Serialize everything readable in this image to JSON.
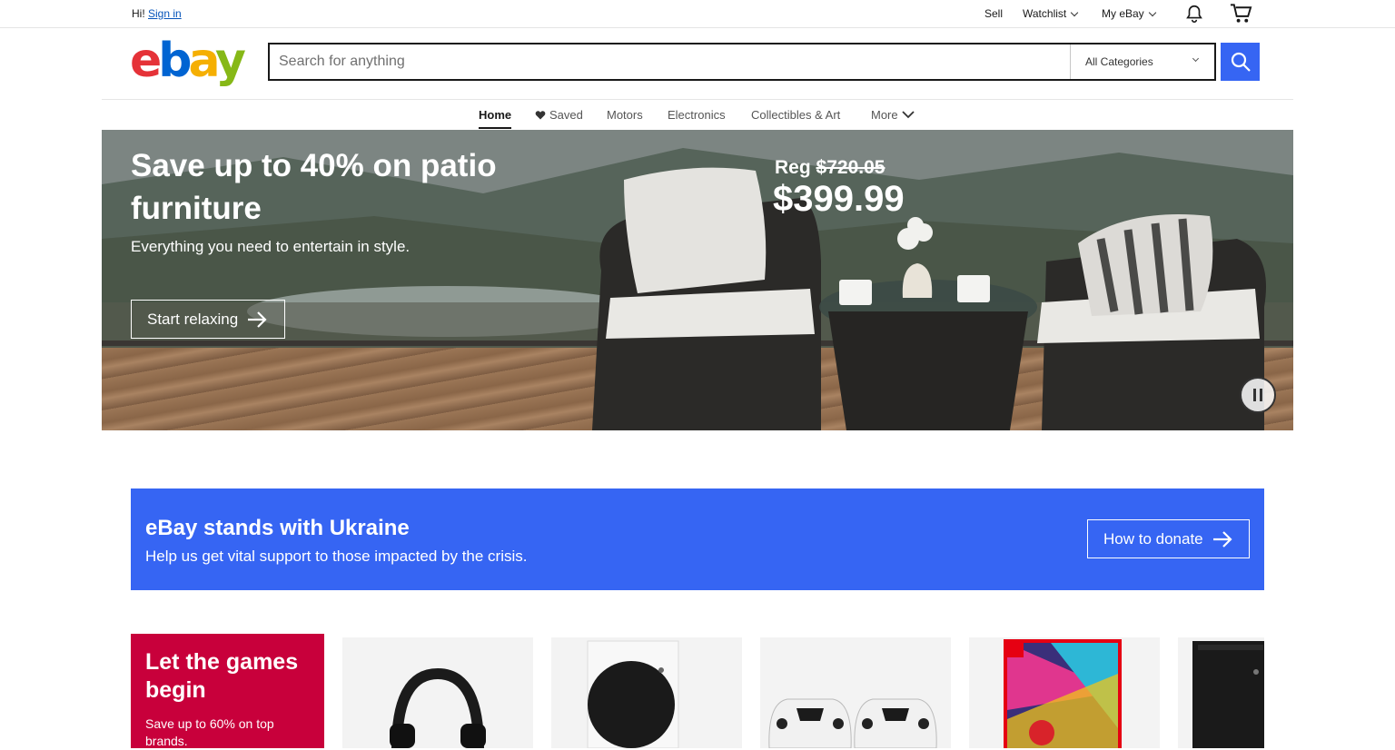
{
  "topbar": {
    "greeting": "Hi!",
    "sign_in": "Sign in",
    "sell": "Sell",
    "watchlist": "Watchlist",
    "my_ebay": "My eBay"
  },
  "header": {
    "logo_letters": [
      "e",
      "b",
      "a",
      "y"
    ],
    "search_placeholder": "Search for anything",
    "category": "All Categories"
  },
  "nav": {
    "items": [
      "Home",
      "Saved",
      "Motors",
      "Electronics",
      "Collectibles & Art",
      "More"
    ]
  },
  "hero": {
    "title": "Save up to 40% on patio furniture",
    "subtitle": "Everything you need to entertain in style.",
    "cta": "Start relaxing",
    "reg_label": "Reg",
    "reg_price": "$720.05",
    "price": "$399.99"
  },
  "ukraine": {
    "title": "eBay stands with Ukraine",
    "subtitle": "Help us get vital support to those impacted by the crisis.",
    "cta": "How to donate"
  },
  "games": {
    "title": "Let the games begin",
    "subtitle": "Save up to 60% on top brands."
  },
  "colors": {
    "brand_blue": "#3665f3",
    "games_red": "#c8003b",
    "logo_red": "#e53238",
    "logo_blue": "#0064d2",
    "logo_yellow": "#f5af02",
    "logo_green": "#86b817"
  },
  "tiles": [
    {
      "icon": "headset-icon"
    },
    {
      "icon": "xbox-series-s-icon"
    },
    {
      "icon": "ps5-controllers-icon"
    },
    {
      "icon": "mario-kart-game-icon"
    },
    {
      "icon": "xbox-series-x-icon"
    }
  ]
}
